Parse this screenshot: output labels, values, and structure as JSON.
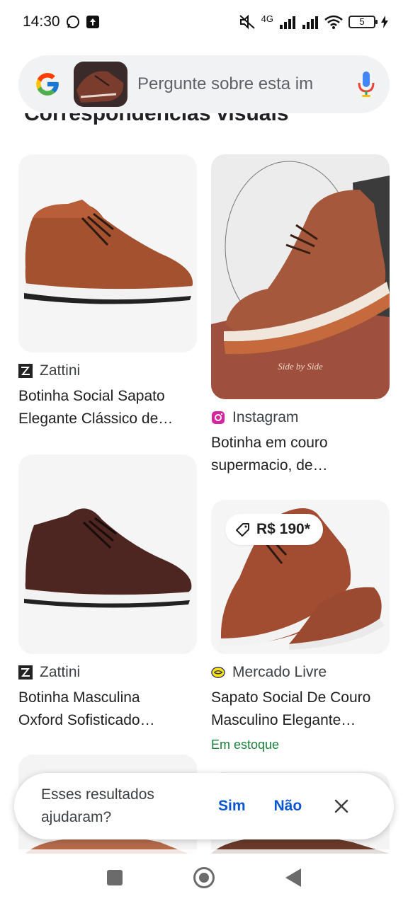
{
  "status_bar": {
    "time": "14:30",
    "network": "4G",
    "battery": "5"
  },
  "search": {
    "placeholder": "Pergunte sobre esta im"
  },
  "section": {
    "heading": "Correspondências visuais"
  },
  "results": [
    {
      "source": "Zattini",
      "title_line1": "Botinha Social Sapato",
      "title_line2": "Elegante Clássico de…"
    },
    {
      "source": "Instagram",
      "title_line1": "Botinha em couro",
      "title_line2": "supermacio, de…",
      "watermark": "Side by Side"
    },
    {
      "source": "Zattini",
      "title_line1": "Botinha Masculina",
      "title_line2": "Oxford Sofisticado…"
    },
    {
      "source": "Mercado Livre",
      "price": "R$ 190*",
      "title_line1": "Sapato Social De Couro",
      "title_line2": "Masculino Elegante…",
      "stock": "Em estoque"
    }
  ],
  "feedback": {
    "question": "Esses resultados ajudaram?",
    "yes": "Sim",
    "no": "Não"
  },
  "colors": {
    "accent": "#0b57d0",
    "stock_green": "#188038",
    "leather": "#a0522d"
  }
}
